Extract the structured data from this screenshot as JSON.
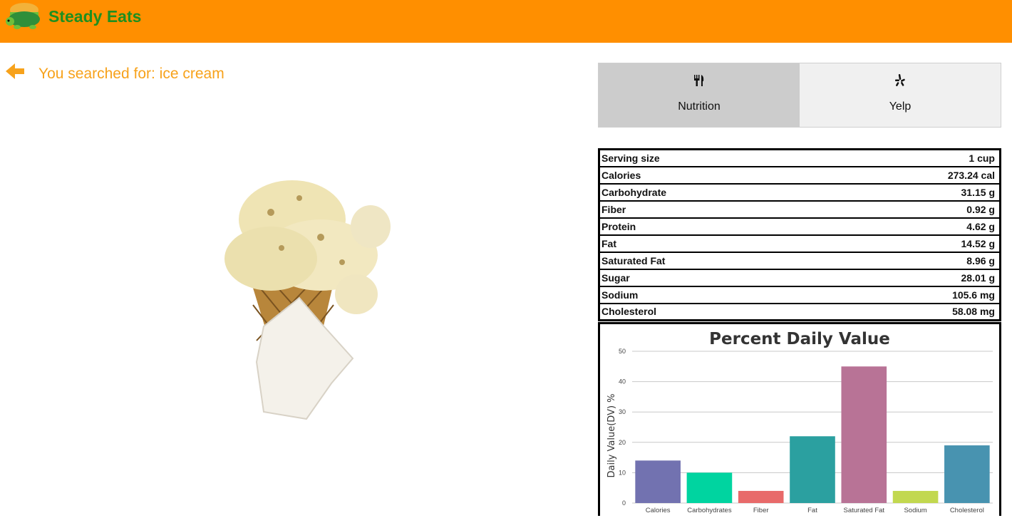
{
  "app": {
    "brand": "Steady Eats"
  },
  "search": {
    "label": "You searched for: ice cream"
  },
  "tabs": [
    {
      "label": "Nutrition",
      "icon": "fork-knife-icon",
      "active": true
    },
    {
      "label": "Yelp",
      "icon": "yelp-icon",
      "active": false
    }
  ],
  "nutrition": [
    {
      "name": "Serving size",
      "value": "1 cup"
    },
    {
      "name": "Calories",
      "value": "273.24 cal"
    },
    {
      "name": "Carbohydrate",
      "value": "31.15 g"
    },
    {
      "name": "Fiber",
      "value": "0.92 g"
    },
    {
      "name": "Protein",
      "value": "4.62 g"
    },
    {
      "name": "Fat",
      "value": "14.52 g"
    },
    {
      "name": "Saturated Fat",
      "value": "8.96 g"
    },
    {
      "name": "Sugar",
      "value": "28.01 g"
    },
    {
      "name": "Sodium",
      "value": "105.6 mg"
    },
    {
      "name": "Cholesterol",
      "value": "58.08 mg"
    }
  ],
  "colors": {
    "header": "#ff8f00",
    "brand": "#1f8f1f",
    "search": "#f7a21b"
  },
  "chart_data": {
    "type": "bar",
    "title": "Percent Daily Value",
    "ylabel": "Daily Value(DV) %",
    "xlabel": "",
    "ylim": [
      0,
      50
    ],
    "yticks": [
      0,
      10,
      20,
      30,
      40,
      50
    ],
    "grid": true,
    "categories": [
      "Calories",
      "Carbohydrates",
      "Fiber",
      "Fat",
      "Saturated Fat",
      "Sodium",
      "Cholesterol"
    ],
    "values": [
      14,
      10,
      4,
      22,
      45,
      4,
      19
    ],
    "colors": [
      "#7272b0",
      "#00d4a0",
      "#e86a6a",
      "#2ba0a0",
      "#b87396",
      "#c2d84f",
      "#4893b0"
    ]
  }
}
